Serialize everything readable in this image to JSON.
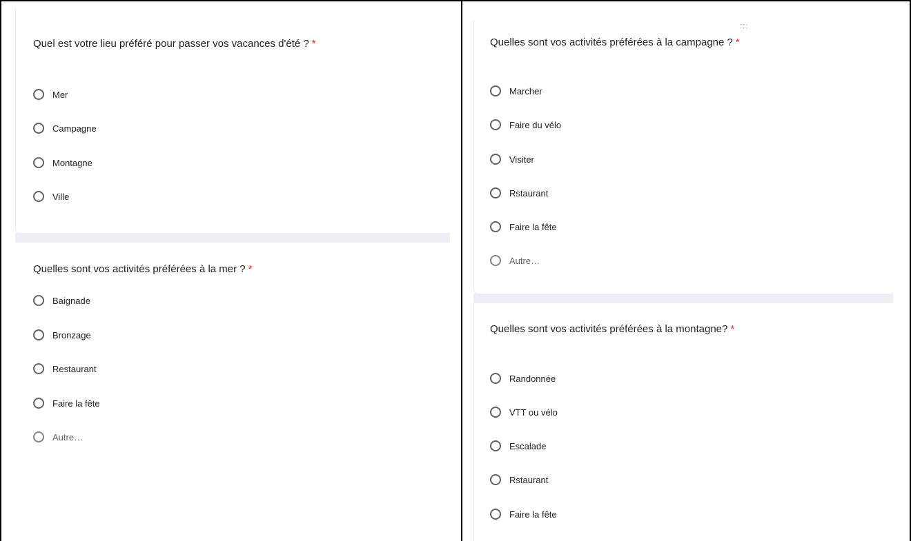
{
  "required_mark": "*",
  "drag_handle": ":::",
  "q1": {
    "title": "Quel est votre lieu préféré pour passer vos vacances d'été ?",
    "options": [
      "Mer",
      "Campagne",
      "Montagne",
      "Ville"
    ]
  },
  "q2": {
    "title": "Quelles sont vos activités préférées à la mer ?",
    "options": [
      "Baignade",
      "Bronzage",
      "Restaurant",
      "Faire la fête",
      "Autre…"
    ]
  },
  "q3": {
    "title": "Quelles sont vos activités préférées à la campagne ?",
    "options": [
      "Marcher",
      "Faire du vélo",
      "Visiter",
      "Rstaurant",
      "Faire la fête",
      "Autre…"
    ]
  },
  "q4": {
    "title": "Quelles sont vos activités préférées à la montagne?",
    "options": [
      "Randonnée",
      "VTT ou vélo",
      "Escalade",
      "Rstaurant",
      "Faire la fête"
    ]
  },
  "colors": {
    "required": "#d93025",
    "section_gap": "#eeeef5",
    "radio_border": "#5f6368"
  }
}
